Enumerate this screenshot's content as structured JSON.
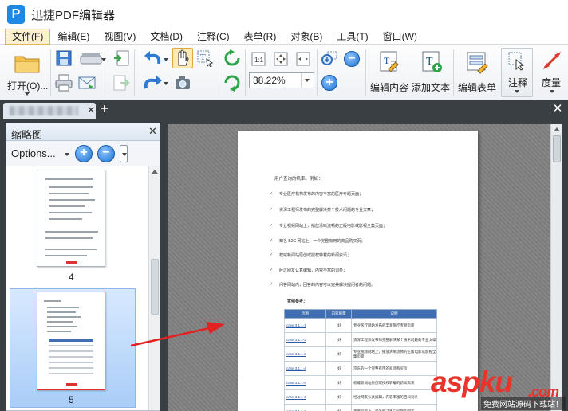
{
  "app": {
    "title": "迅捷PDF编辑器",
    "logo_letter": "P"
  },
  "menu": [
    "文件(F)",
    "编辑(E)",
    "视图(V)",
    "文档(D)",
    "注释(C)",
    "表单(R)",
    "对象(B)",
    "工具(T)",
    "窗口(W)"
  ],
  "toolbar": {
    "open_label": "打开(O)...",
    "zoom_value": "38.22%",
    "edit_content_label": "编辑内容",
    "add_text_label": "添加文本",
    "edit_form_label": "编辑表单",
    "annotate_label": "注释",
    "measure_label": "度量"
  },
  "tabs": {
    "add": "+",
    "close": "✕",
    "tab_close": "✕"
  },
  "thumbnail_panel": {
    "title": "缩略图",
    "close": "✕",
    "options_label": "Options...",
    "pages": [
      {
        "number": "4"
      },
      {
        "number": "5",
        "selected": true
      }
    ]
  },
  "document": {
    "intro": "用户查询的机率。例如：",
    "bullets": [
      "专业医疗机构发布的内容丰富的医疗专题页面；",
      "资深工程师发布的完整解决某个技术问题的专业文章；",
      "专业视频网站上，播放清晰流畅的正版电影或影视全集页面；",
      "知名 B2C 网站上，一个完整有用的商品购买页；",
      "权威新闻站原创或授权转载的新闻资讯；",
      "经过网友认真编辑，内容丰富的词条；",
      "问答网站内，回答的内容可以完美解决提问者的问题。"
    ],
    "table_title": "实例参考：",
    "table_headers": [
      "示例",
      "内容质量",
      "说明"
    ],
    "table_rows": [
      [
        "case 3.1.1-1",
        "好",
        "专业医疗网站发布的丰富医疗专题页面"
      ],
      [
        "case 3.1.1-2",
        "好",
        "资深工程师发布的完整解决某个技术问题的专业文章"
      ],
      [
        "case 3.1.1-3",
        "好",
        "专业视频网站上，播放清晰流畅的正版电影或影视全集页面"
      ],
      [
        "case 3.1.1-4",
        "好",
        "京东的一个完整有用的商品购买页"
      ],
      [
        "case 3.1.1-5",
        "好",
        "权威新闻站原创或授权转载的新闻资讯"
      ],
      [
        "case 3.1.1-6",
        "好",
        "经过网友认真编辑，内容丰富的百科词条"
      ],
      [
        "case 3.1.1-7",
        "好",
        "百度知道上，完美解决用户问题的回答"
      ]
    ]
  },
  "watermark": {
    "main": "aspku",
    "domain": ".com",
    "sub": "免费网站源码下载站！"
  },
  "colors": {
    "accent": "#1c6fcf",
    "arrow": "#e22323",
    "dark_bg": "#3a3f44",
    "selected_menu": "#fdf0cf"
  }
}
